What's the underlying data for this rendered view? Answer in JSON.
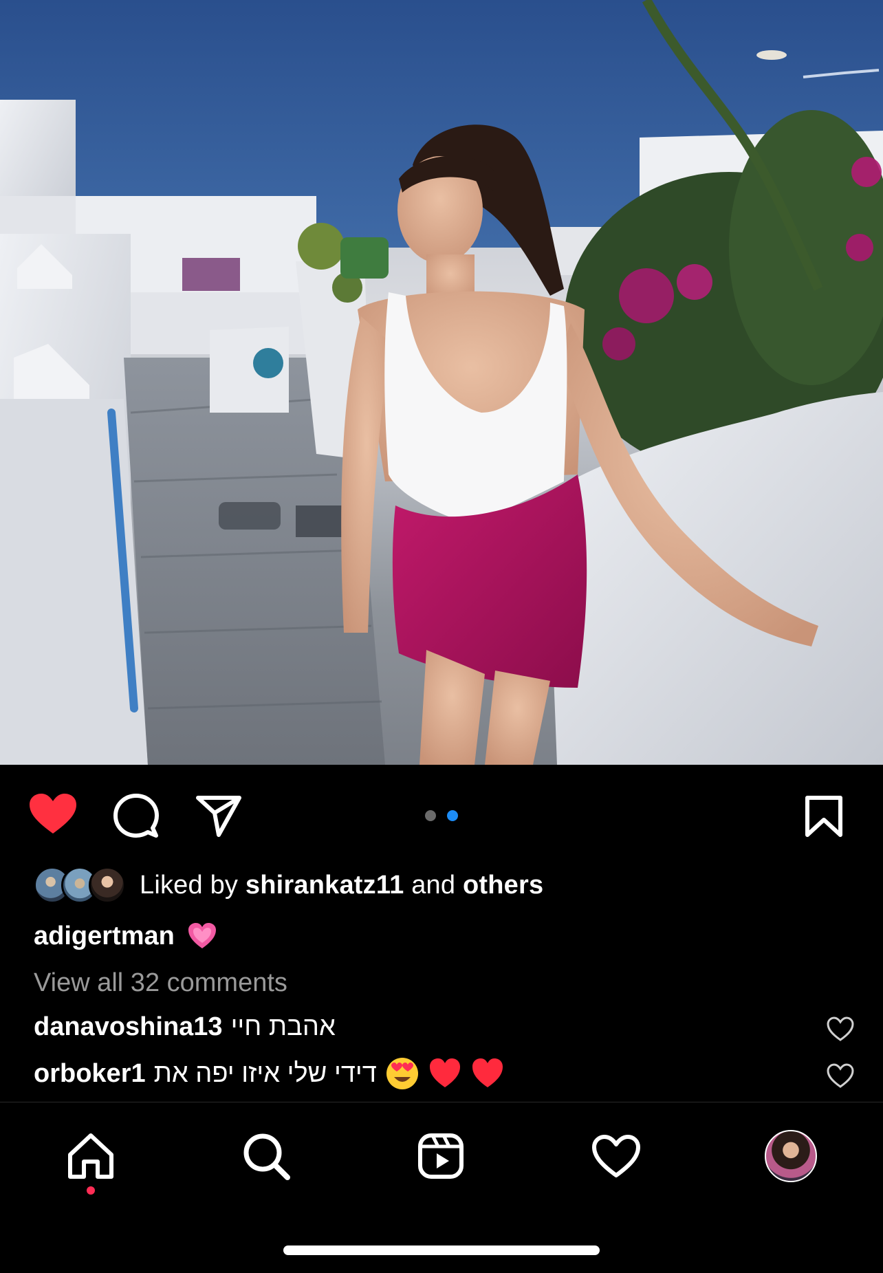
{
  "post": {
    "photo_alt": "",
    "carousel": {
      "count": 2,
      "active_index": 1
    },
    "liked": true,
    "saved": false
  },
  "likes": {
    "prefix": "Liked by",
    "user": "shirankatz11",
    "conjunction": "and",
    "others": "others"
  },
  "caption": {
    "username": "adigertman",
    "emoji": "pink-heart-emoji"
  },
  "comments_link": "View all 32 comments",
  "comments": [
    {
      "username": "danavoshina13",
      "text": "אהבת חיי",
      "emojis": []
    },
    {
      "username": "orboker1",
      "text": "דידי שלי איזו יפה את",
      "emojis": [
        "heart-eyes-emoji",
        "red-heart-emoji",
        "red-heart-emoji"
      ]
    }
  ],
  "colors": {
    "like_active": "#ff3040",
    "dot_active": "#1d8cf5",
    "dot_inactive": "#6b6b6b",
    "muted_text": "#9a9a9a"
  },
  "nav": {
    "items": [
      "home-icon",
      "search-icon",
      "reels-icon",
      "activity-heart-icon",
      "profile-avatar"
    ],
    "active": "home-icon"
  }
}
